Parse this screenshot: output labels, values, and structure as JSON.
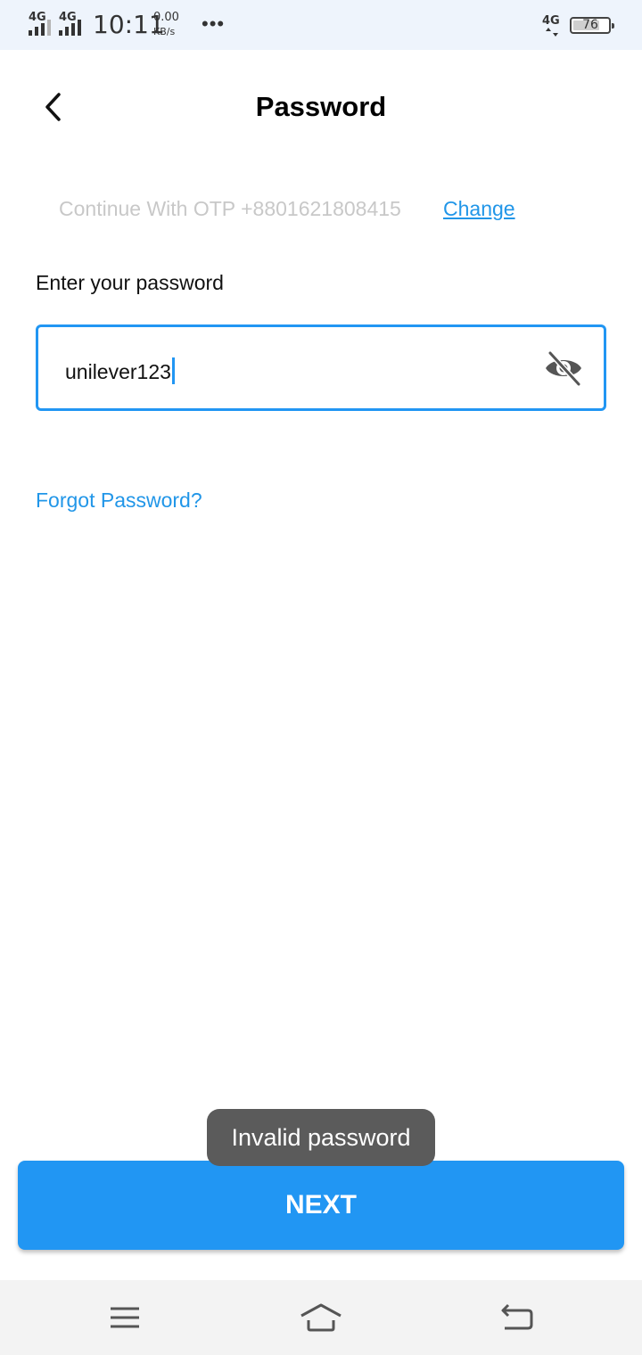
{
  "status_bar": {
    "network_1": "4G",
    "network_2": "4G",
    "time": "10:11",
    "net_speed_value": "0.00",
    "net_speed_unit": "KB/s",
    "more_icon": "more-dots",
    "network_3": "4G",
    "battery_level": "76"
  },
  "header": {
    "back_icon": "chevron-left",
    "title": "Password"
  },
  "otp": {
    "text": "Continue With OTP +8801621808415",
    "change_label": "Change"
  },
  "form": {
    "label": "Enter your password",
    "password_value": "unilever123",
    "visibility_icon": "eye-off"
  },
  "forgot_label": "Forgot Password?",
  "toast": "Invalid password",
  "next_label": "NEXT",
  "nav": {
    "menu_icon": "menu",
    "home_icon": "home",
    "back_icon": "back"
  },
  "colors": {
    "accent": "#2196f3",
    "link": "#2196e8",
    "toast_bg": "#5b5b5b",
    "status_bar_bg": "#eef4fc"
  }
}
